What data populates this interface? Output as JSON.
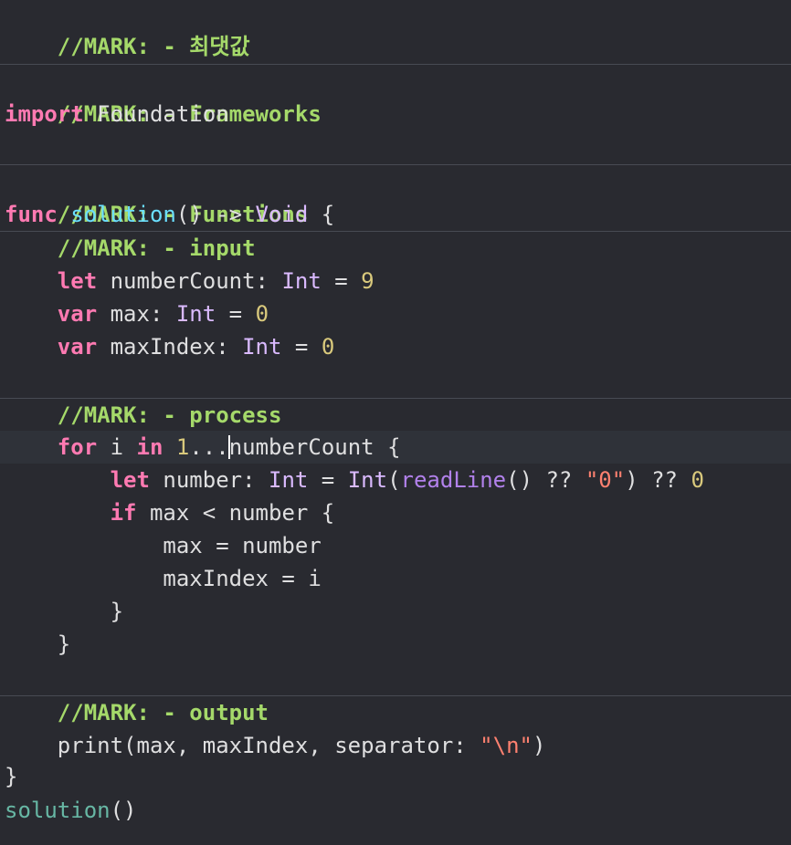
{
  "editor": {
    "colors": {
      "background": "#292a30",
      "current_line": "#2f3239",
      "separator": "#484b53",
      "mark_comment": "#a5d96a",
      "keyword": "#ff7ab2",
      "type": "#dabaff",
      "function_decl": "#6bdfff",
      "project_function": "#67b7a4",
      "number": "#d9c97c",
      "string": "#ff8170",
      "stdlib_function": "#b281eb",
      "plain": "#dfdfe0"
    },
    "marks": {
      "max_value": "//MARK: - 최댓값",
      "frameworks": "//MARK: - Frameworks",
      "functions": "//MARK: - Functions",
      "input": "//MARK: - input",
      "process": "//MARK: - process",
      "output": "//MARK: - output"
    },
    "tokens": {
      "import_kw": "import",
      "foundation": "Foundation",
      "func_kw": "func",
      "solution_name": "solution",
      "sig_tail": "() -> ",
      "void_type": "Void",
      "brace_open": " {",
      "let_kw": "let",
      "var_kw": "var",
      "for_kw": "for",
      "in_kw": "in",
      "if_kw": "if",
      "number_count_decl": "numberCount: ",
      "int_type": "Int",
      "assign": " = ",
      "nine": "9",
      "zero": "0",
      "max_decl": "max: ",
      "max_index_decl": "maxIndex: ",
      "i_var": " i ",
      "one": "1",
      "range_dots": "...",
      "range_rest": "numberCount {",
      "number_decl": "number: ",
      "int_call": "Int",
      "paren_open": "(",
      "readline": "readLine",
      "readline_tail": "() ?? ",
      "string_zero": "\"0\"",
      "nil_coalesce": ") ?? ",
      "if_cond": "max < number {",
      "max_assign": "max = number",
      "max_index_assign": "maxIndex = i",
      "brace_close": "}",
      "print_stmt": "print(max, maxIndex, separator: ",
      "string_newline": "\"\\n\"",
      "paren_close": ")",
      "solution_call": "solution",
      "call_parens": "()"
    }
  }
}
